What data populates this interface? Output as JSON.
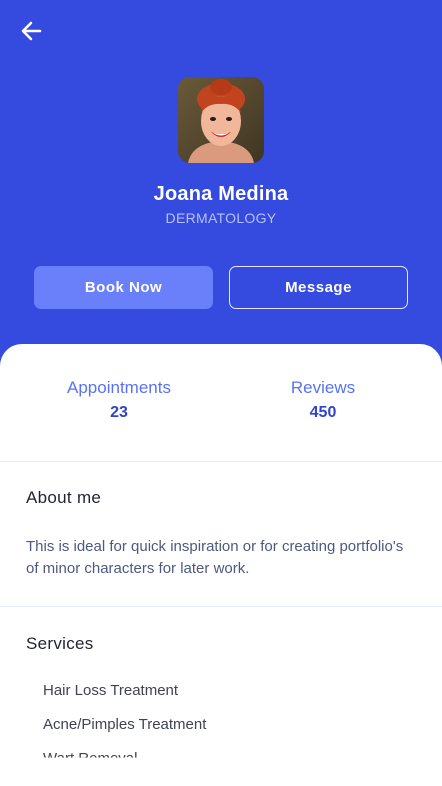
{
  "profile": {
    "name": "Joana Medina",
    "specialty": "DERMATOLOGY"
  },
  "actions": {
    "book_label": "Book Now",
    "message_label": "Message"
  },
  "stats": {
    "appointments_label": "Appointments",
    "appointments_value": "23",
    "reviews_label": "Reviews",
    "reviews_value": "450"
  },
  "about": {
    "title": "About me",
    "text": "This is ideal for quick inspiration or for creating portfolio's of minor characters for later work."
  },
  "services": {
    "title": "Services",
    "items": [
      "Hair Loss Treatment",
      "Acne/Pimples Treatment",
      "Wart Removal"
    ]
  },
  "colors": {
    "header": "#354be0",
    "accent": "#5a72f3",
    "book_button": "#6a7ffa"
  },
  "icons": {
    "back": "arrow-left-icon"
  }
}
